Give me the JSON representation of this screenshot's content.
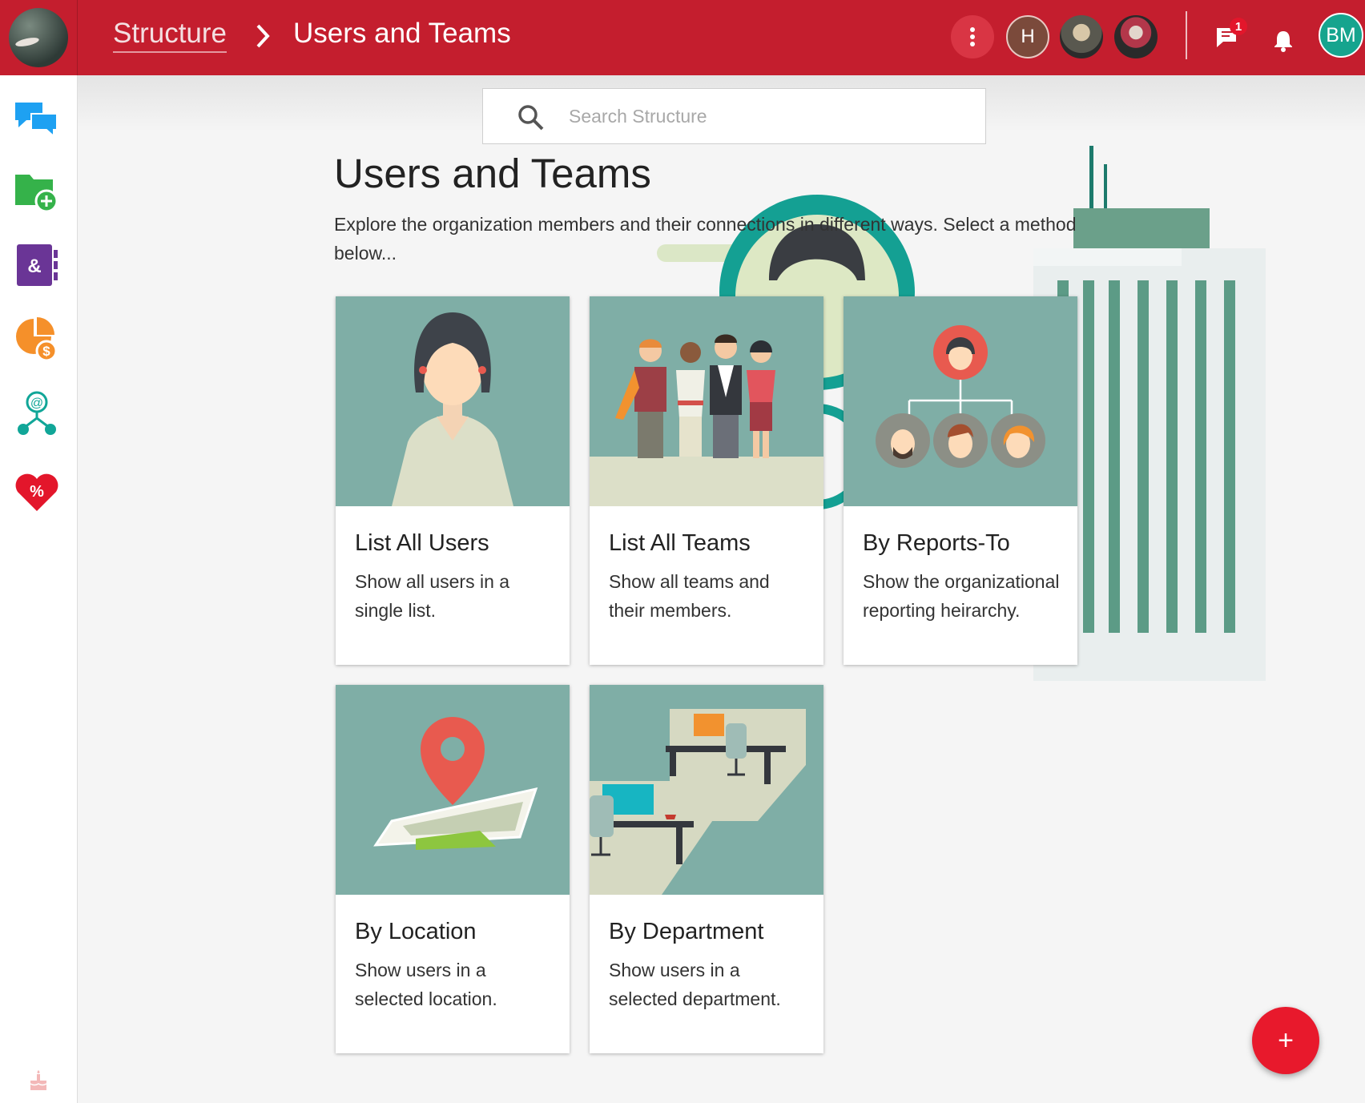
{
  "app": {
    "logo_icon": "app-logo-photo",
    "brand_color": "#c41e2e"
  },
  "header": {
    "breadcrumb": {
      "parent": "Structure",
      "current": "Users and Teams"
    },
    "more_icon": "vertical-dots-icon",
    "avatars": [
      {
        "initials": "H",
        "color": "#7b4a3b"
      },
      {
        "icon": "user-photo-avatar"
      },
      {
        "icon": "user-photo-avatar"
      }
    ],
    "messages_badge": "1",
    "user_initials": "BM",
    "user_color": "#16a48e"
  },
  "sidebar": {
    "items": [
      {
        "icon": "chat-bubbles-icon",
        "color": "#1ea1f2"
      },
      {
        "icon": "folder-add-icon",
        "color": "#35b24a"
      },
      {
        "icon": "contacts-book-icon",
        "color": "#6a3596"
      },
      {
        "icon": "pie-chart-money-icon",
        "color": "#f5902a"
      },
      {
        "icon": "network-mention-icon",
        "color": "#11a698"
      },
      {
        "icon": "heart-percent-icon",
        "color": "#e3162b"
      }
    ],
    "footer_icon": "cake-icon"
  },
  "search": {
    "placeholder": "Search Structure",
    "value": ""
  },
  "main": {
    "title": "Users and Teams",
    "description": "Explore the organization members and their connections in different ways. Select a method below...",
    "cards": [
      {
        "title": "List All Users",
        "description": "Show all users in a single list."
      },
      {
        "title": "List All Teams",
        "description": "Show all teams and their members."
      },
      {
        "title": "By Reports-To",
        "description": "Show the organizational reporting heirarchy."
      },
      {
        "title": "By Location",
        "description": "Show users in a selected location."
      },
      {
        "title": "By Department",
        "description": "Show users in a selected department."
      }
    ]
  },
  "fab": {
    "label": "+",
    "color": "#e8192c"
  }
}
